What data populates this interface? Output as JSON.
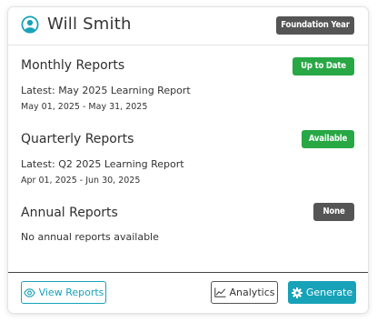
{
  "header": {
    "student_name": "Will Smith",
    "year_badge": "Foundation Year",
    "avatar_icon": "user-circle-icon"
  },
  "sections": {
    "monthly": {
      "title": "Monthly Reports",
      "status": "Up to Date",
      "latest": "Latest: May 2025 Learning Report",
      "range": "May 01, 2025 - May 31, 2025"
    },
    "quarterly": {
      "title": "Quarterly Reports",
      "status": "Available",
      "latest": "Latest: Q2 2025 Learning Report",
      "range": "Apr 01, 2025 - Jun 30, 2025"
    },
    "annual": {
      "title": "Annual Reports",
      "status": "None",
      "empty_text": "No annual reports available"
    }
  },
  "footer": {
    "view_reports_label": "View Reports",
    "analytics_label": "Analytics",
    "generate_label": "Generate"
  },
  "colors": {
    "accent": "#17a2b8",
    "success": "#28a745",
    "neutral_badge": "#555555"
  }
}
